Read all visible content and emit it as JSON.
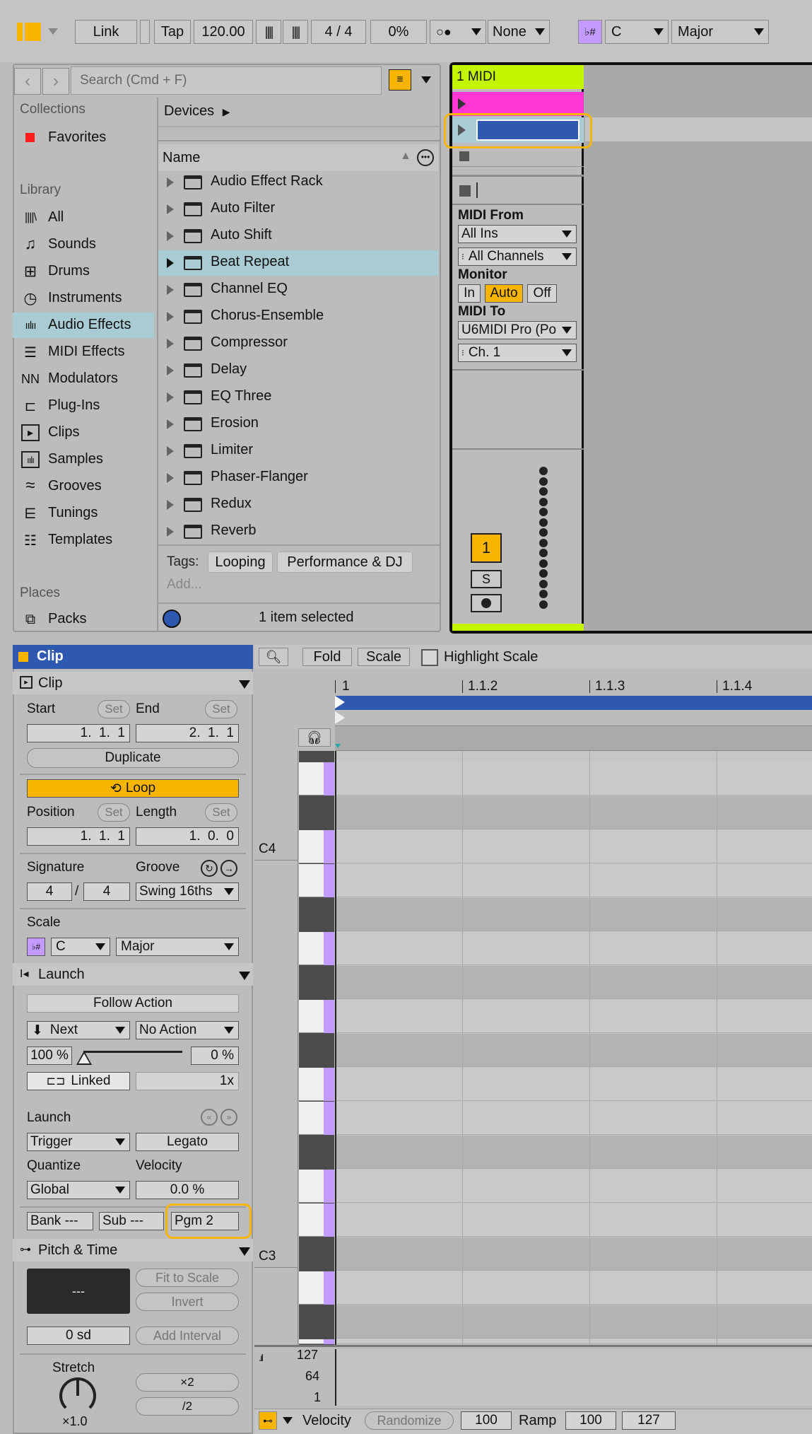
{
  "colors": {
    "accent": "#f7b500",
    "clip_blue": "#2f58b0",
    "track_green": "#c3f400",
    "clip_pink": "#ff36d4",
    "purple": "#c39bff",
    "highlight_blue": "#a9cbd4"
  },
  "toolbar": {
    "link": "Link",
    "tap": "Tap",
    "tempo": "120.00",
    "time_sig": "4 / 4",
    "groove_amount": "0%",
    "quantize": "None",
    "scale_root": "C",
    "scale_mode": "Major"
  },
  "browser": {
    "search_placeholder": "Search (Cmd + F)",
    "collections_heading": "Collections",
    "favorites": "Favorites",
    "library_heading": "Library",
    "library_items": [
      "All",
      "Sounds",
      "Drums",
      "Instruments",
      "Audio Effects",
      "MIDI Effects",
      "Modulators",
      "Plug-Ins",
      "Clips",
      "Samples",
      "Grooves",
      "Tunings",
      "Templates"
    ],
    "places_heading": "Places",
    "places_items": [
      "Packs"
    ],
    "breadcrumb": "Devices",
    "column_name": "Name",
    "devices": [
      "Audio Effect Rack",
      "Auto Filter",
      "Auto Shift",
      "Beat Repeat",
      "Channel EQ",
      "Chorus-Ensemble",
      "Compressor",
      "Delay",
      "EQ Three",
      "Erosion",
      "Limiter",
      "Phaser-Flanger",
      "Redux",
      "Reverb"
    ],
    "tags_label": "Tags:",
    "tags": [
      "Looping",
      "Performance & DJ"
    ],
    "add_tag": "Add...",
    "status": "1 item selected"
  },
  "track": {
    "name": "1 MIDI",
    "midi_from_label": "MIDI From",
    "midi_from": "All Ins",
    "channel_in": "All Channels",
    "monitor_label": "Monitor",
    "monitor_in": "In",
    "monitor_auto": "Auto",
    "monitor_off": "Off",
    "midi_to_label": "MIDI To",
    "midi_to": "U6MIDI Pro (Po",
    "channel_out": "Ch. 1",
    "track_number": "1",
    "solo": "S"
  },
  "clip": {
    "header": "Clip",
    "section_clip": "Clip",
    "start_label": "Start",
    "end_label": "End",
    "set": "Set",
    "start": "1.  1.  1",
    "end": "2.  1.  1",
    "duplicate": "Duplicate",
    "loop": "Loop",
    "position_label": "Position",
    "length_label": "Length",
    "position": "1.  1.  1",
    "length": "1.  0.  0",
    "signature_label": "Signature",
    "groove_label": "Groove",
    "sig_num": "4",
    "sig_den": "4",
    "sig_slash": "/",
    "groove": "Swing 16ths",
    "scale_label": "Scale",
    "scale_root": "C",
    "scale_mode": "Major",
    "section_launch": "Launch",
    "follow_action": "Follow Action",
    "fa_a": "Next",
    "fa_b": "No Action",
    "fa_chance_a": "100 %",
    "fa_chance_b": "0 %",
    "linked": "Linked",
    "linked_mult": "1x",
    "launch_label": "Launch",
    "launch_mode": "Trigger",
    "legato": "Legato",
    "quantize_label": "Quantize",
    "velocity_label": "Velocity",
    "quantize": "Global",
    "velocity": "0.0 %",
    "bank": "Bank ---",
    "sub": "Sub ---",
    "pgm": "Pgm 2",
    "section_pitch": "Pitch & Time",
    "transpose_display": "---",
    "fit_to_scale": "Fit to Scale",
    "invert": "Invert",
    "transpose": "0 sd",
    "add_interval": "Add Interval",
    "stretch_label": "Stretch",
    "stretch_value": "×1.0",
    "double": "×2",
    "half": "/2"
  },
  "editor": {
    "fold": "Fold",
    "scale": "Scale",
    "highlight_scale": "Highlight Scale",
    "ruler": [
      "1",
      "1.1.2",
      "1.1.3",
      "1.1.4"
    ],
    "note_c4": "C4",
    "note_c3": "C3",
    "vel_ticks": [
      "127",
      "64",
      "1"
    ],
    "velocity_label": "Velocity",
    "randomize": "Randomize",
    "vel_value": "100",
    "ramp_label": "Ramp",
    "ramp_a": "100",
    "ramp_b": "127"
  }
}
